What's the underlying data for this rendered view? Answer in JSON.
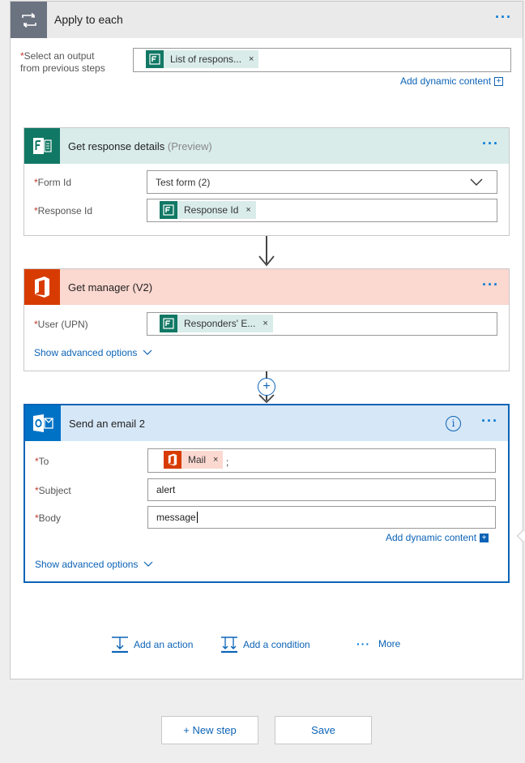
{
  "apply": {
    "title": "Apply to each",
    "select_label": "Select an output",
    "select_label_2": "from previous steps",
    "token": "List of respons...",
    "add_dynamic": "Add dynamic content",
    "add_box": "+"
  },
  "response_card": {
    "title": "Get response details",
    "preview": "(Preview)",
    "form_id_label": "Form Id",
    "form_id_value": "Test form (2)",
    "response_id_label": "Response Id",
    "response_id_token": "Response Id"
  },
  "manager_card": {
    "title": "Get manager (V2)",
    "user_label": "User (UPN)",
    "user_token": "Responders' E...",
    "advanced": "Show advanced options"
  },
  "email_card": {
    "title": "Send an email 2",
    "to_label": "To",
    "to_token": "Mail",
    "to_suffix": ";",
    "subject_label": "Subject",
    "subject_value": "alert",
    "body_label": "Body",
    "body_value": "message",
    "add_dynamic": "Add dynamic content",
    "add_box": "+",
    "advanced": "Show advanced options"
  },
  "actions": {
    "add_action": "Add an action",
    "add_condition": "Add a condition",
    "more": "More"
  },
  "footer": {
    "new_step": "+ New step",
    "save": "Save"
  },
  "common": {
    "required_mark": "*",
    "token_remove": "×",
    "dots": "···",
    "plus": "+"
  },
  "colors": {
    "accent": "#0b63b6",
    "forms_green": "#117865",
    "office_orange": "#d83b01",
    "outlook_blue": "#0072c6"
  }
}
